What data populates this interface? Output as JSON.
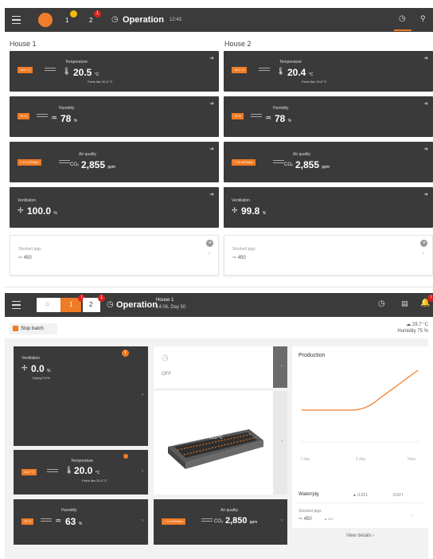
{
  "screen1": {
    "header": {
      "tab1": "1",
      "tab2": "2",
      "title": "Operation",
      "time": "12:43"
    },
    "houses": [
      {
        "title": "House 1",
        "temperature": {
          "label": "Temperature",
          "set": "18.0 °C",
          "value": "20.5",
          "unit": "°C",
          "feels": "Feels like 20.5 °C"
        },
        "humidity": {
          "label": "Humidity",
          "set": "75 %",
          "value": "78",
          "unit": "%"
        },
        "air": {
          "label": "Air quality",
          "set": "7.10 m³/h/anl.",
          "gas": "CO₂",
          "value": "2,855",
          "unit": "ppm"
        },
        "ventilation": {
          "label": "Ventilation",
          "value": "100.0",
          "unit": "%"
        },
        "stocked": {
          "label": "Stocked pigs",
          "value": "450"
        }
      },
      {
        "title": "House 2",
        "temperature": {
          "label": "Temperature",
          "set": "18.0 °C",
          "value": "20.4",
          "unit": "°C",
          "feels": "Feels like 19.8 °C"
        },
        "humidity": {
          "label": "Humidity",
          "set": "75 %",
          "value": "78",
          "unit": "%"
        },
        "air": {
          "label": "Air quality",
          "set": "7.10 m³/h/anl.",
          "gas": "CO₂",
          "value": "2,855",
          "unit": "ppm"
        },
        "ventilation": {
          "label": "Ventilation",
          "value": "99.8",
          "unit": "%"
        },
        "stocked": {
          "label": "Stocked pigs",
          "value": "450"
        }
      }
    ]
  },
  "screen2": {
    "header": {
      "tab1": "1",
      "tab2": "2",
      "title": "Operation",
      "house": "House 1",
      "subtitle": "14:06, Day 50"
    },
    "stop_batch": "Stop batch",
    "weather": {
      "temp": "29.7 °C",
      "humidity": "Humidity 75 %"
    },
    "ventilation": {
      "label": "Ventilation",
      "value": "0.0",
      "unit": "%",
      "drying": "Drying 0.0%"
    },
    "temperature": {
      "label": "Temperature",
      "set": "18.0 °C",
      "value": "20.0",
      "unit": "°C",
      "feels": "Feels like 20.0 °C"
    },
    "humidity": {
      "label": "Humidity",
      "set": "75 %",
      "value": "63",
      "unit": "%"
    },
    "timer": {
      "status": "OFF"
    },
    "pen": {
      "temp": "20.0 °C"
    },
    "air": {
      "label": "Air quality",
      "set": "7.10 m³/h/anl.",
      "gas": "CO₂",
      "value": "2,850",
      "unit": "ppm"
    },
    "production": {
      "title": "Production",
      "x_labels": [
        "7 day",
        "2 day",
        "Now"
      ],
      "water_label": "Water/pig",
      "water_v1": "▲ 0.021",
      "water_v2": "0.02 l",
      "stocked_label": "Stocked pigs",
      "stocked_value": "450",
      "stocked_extra": "▲ 450",
      "view_details": "View details ›"
    }
  },
  "chart_data": {
    "type": "line",
    "title": "Production",
    "x": [
      "7 day",
      "2 day",
      "Now"
    ],
    "series": [
      {
        "values": [
          0.0,
          0.0,
          1.0
        ]
      }
    ],
    "color": "#ef7b24",
    "grid": false
  },
  "colors": {
    "accent": "#ef7b24",
    "tile": "#3a3a3a",
    "header": "#3b3b3b",
    "alert": "#d92020",
    "warn": "#f5b70a"
  }
}
